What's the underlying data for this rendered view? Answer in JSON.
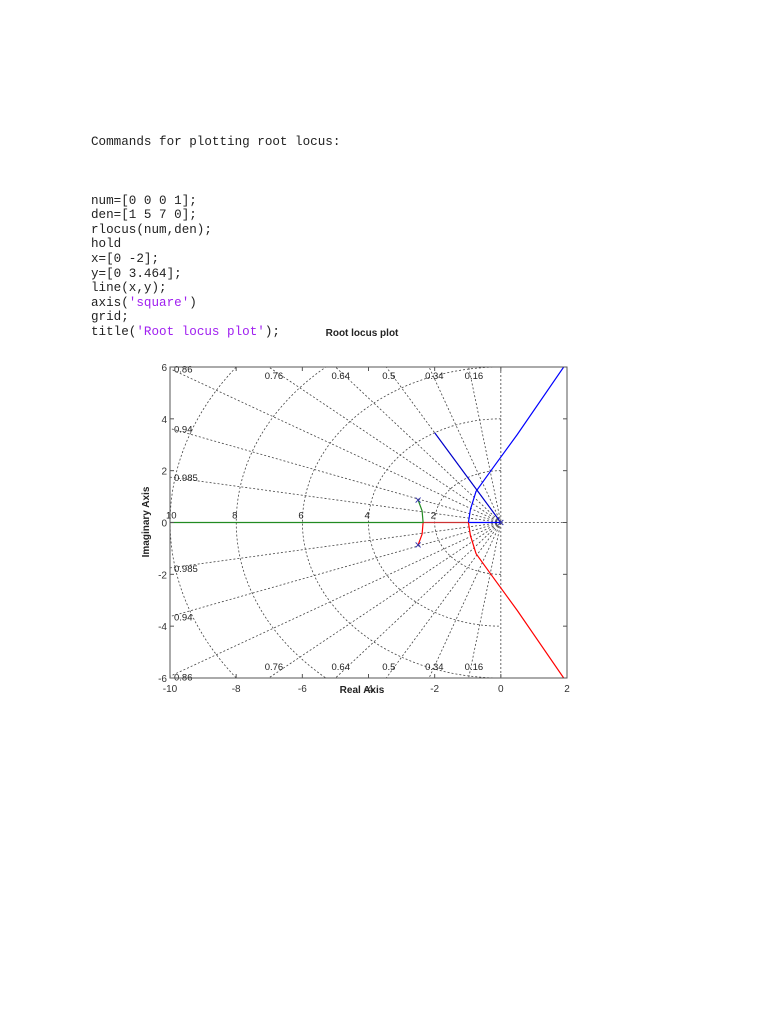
{
  "document": {
    "heading": "Commands for plotting root locus:",
    "code_lines": [
      {
        "pre": "num=[0 0 0 1];",
        "str": "",
        "post": ""
      },
      {
        "pre": "den=[1 5 7 0];",
        "str": "",
        "post": ""
      },
      {
        "pre": "rlocus(num,den);",
        "str": "",
        "post": ""
      },
      {
        "pre": "hold",
        "str": "",
        "post": ""
      },
      {
        "pre": "x=[0 -2];",
        "str": "",
        "post": ""
      },
      {
        "pre": "y=[0 3.464];",
        "str": "",
        "post": ""
      },
      {
        "pre": "line(x,y);",
        "str": "",
        "post": ""
      },
      {
        "pre": "axis(",
        "str": "'square'",
        "post": ")"
      },
      {
        "pre": "grid;",
        "str": "",
        "post": ""
      },
      {
        "pre": "title(",
        "str": "'Root locus plot'",
        "post": ");"
      }
    ]
  },
  "chart_data": {
    "type": "line",
    "title": "Root locus plot",
    "xlabel": "Real Axis",
    "ylabel": "Imaginary Axis",
    "xlim": [
      -10,
      2
    ],
    "ylim": [
      -6,
      6
    ],
    "xticks": [
      -10,
      -8,
      -6,
      -4,
      -2,
      0,
      2
    ],
    "xtick_labels": [
      "-10",
      "-8",
      "-6",
      "-4",
      "-2",
      "0",
      "2"
    ],
    "yticks": [
      -6,
      -4,
      -2,
      0,
      2,
      4,
      6
    ],
    "ytick_labels": [
      "-6",
      "-4",
      "-2",
      "0",
      "2",
      "4",
      "6"
    ],
    "grid": true,
    "damping_ratios": [
      0.16,
      0.34,
      0.5,
      0.64,
      0.76,
      0.86,
      0.94,
      0.985
    ],
    "damping_labels": [
      "0.16",
      "0.34",
      "0.5",
      "0.64",
      "0.76",
      "0.86",
      "0.94",
      "0.985"
    ],
    "natural_frequencies": [
      2,
      4,
      6,
      8,
      10
    ],
    "natural_frequency_labels": [
      "2",
      "4",
      "6",
      "8",
      "10"
    ],
    "poles": [
      [
        0,
        0
      ],
      [
        -2.5,
        0.866
      ],
      [
        -2.5,
        -0.866
      ]
    ],
    "series": [
      {
        "name": "locus-blue",
        "color": "#0000ff",
        "x": [
          0,
          -0.98,
          -0.92,
          -0.75,
          -0.3,
          0.5,
          1.9
        ],
        "y": [
          0,
          0,
          0.5,
          1.2,
          2.0,
          3.4,
          6.0
        ]
      },
      {
        "name": "locus-red",
        "color": "#ff0000",
        "x": [
          -0.98,
          -0.92,
          -0.75,
          -0.3,
          0.5,
          1.9
        ],
        "y": [
          0,
          -0.5,
          -1.2,
          -2.0,
          -3.4,
          -6.0
        ]
      },
      {
        "name": "locus-red-real",
        "color": "#cc3333",
        "x": [
          -2.35,
          -0.98
        ],
        "y": [
          0,
          0
        ]
      },
      {
        "name": "locus-red-upper",
        "color": "#ff0000",
        "x": [
          -2.5,
          -2.38,
          -2.35
        ],
        "y": [
          -0.866,
          -0.45,
          0
        ]
      },
      {
        "name": "locus-green",
        "color": "#228b22",
        "x": [
          -2.5,
          -2.38,
          -2.35,
          -10
        ],
        "y": [
          0.866,
          0.45,
          0,
          0
        ]
      },
      {
        "name": "added-line",
        "color": "#0000cc",
        "x": [
          0,
          -2
        ],
        "y": [
          0,
          3.464
        ]
      }
    ]
  }
}
